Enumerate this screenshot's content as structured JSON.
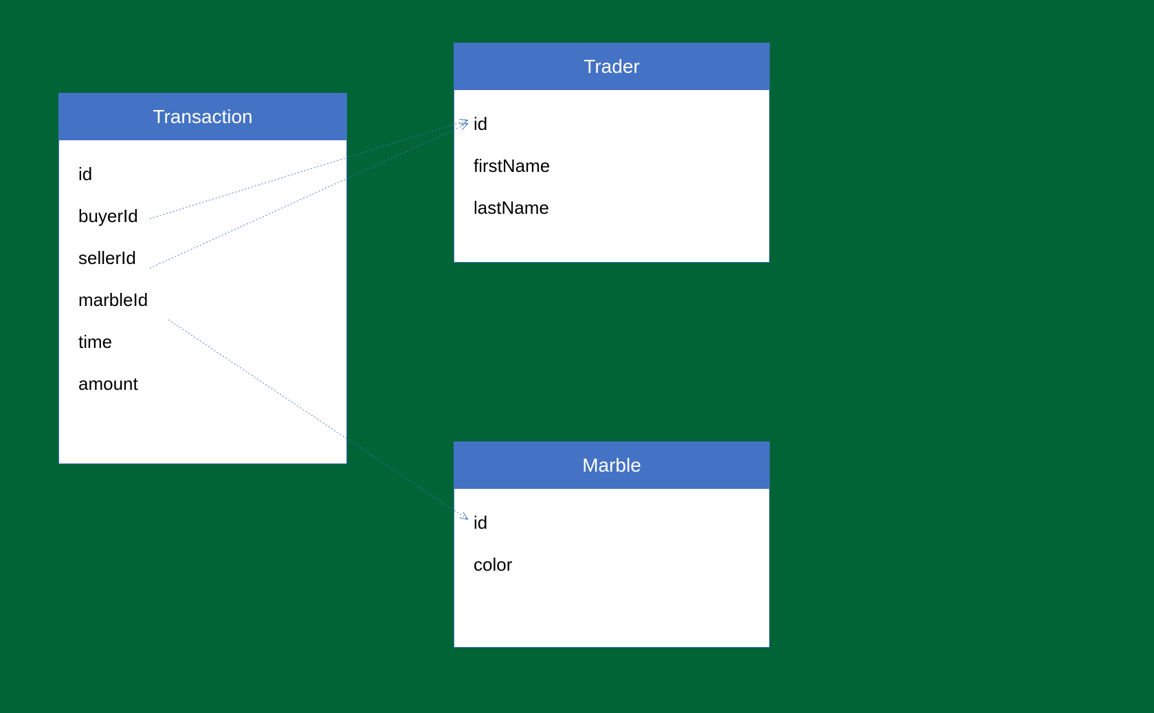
{
  "entities": {
    "transaction": {
      "title": "Transaction",
      "fields": [
        "id",
        "buyerId",
        "sellerId",
        "marbleId",
        "time",
        "amount"
      ]
    },
    "trader": {
      "title": "Trader",
      "fields": [
        "id",
        "firstName",
        "lastName"
      ]
    },
    "marble": {
      "title": "Marble",
      "fields": [
        "id",
        "color"
      ]
    }
  },
  "relations": [
    {
      "from": "transaction.buyerId",
      "to": "trader.id"
    },
    {
      "from": "transaction.sellerId",
      "to": "trader.id"
    },
    {
      "from": "transaction.marbleId",
      "to": "marble.id"
    }
  ],
  "colors": {
    "header": "#4472C4",
    "headerText": "#FFFFFF",
    "border": "#4472C4",
    "body": "#FFFFFF",
    "fieldText": "#000000",
    "arrow": "#4472C4",
    "background": "#006437"
  }
}
